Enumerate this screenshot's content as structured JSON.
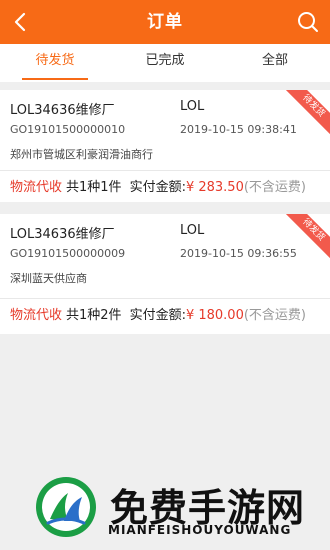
{
  "header": {
    "title": "订单",
    "back_icon": "chevron-left-icon",
    "search_icon": "search-icon"
  },
  "tabs": [
    {
      "label": "待发货",
      "active": true
    },
    {
      "label": "已完成",
      "active": false
    },
    {
      "label": "全部",
      "active": false
    }
  ],
  "orders": [
    {
      "shop": "LOL34636维修厂",
      "buyer": "LOL",
      "order_no": "GO19101500000010",
      "time": "2019-10-15 09:38:41",
      "supplier": "郑州市管城区利豪润滑油商行",
      "type_tag": "物流代收",
      "quantity": "共1种1件",
      "pay_label": "实付金额:",
      "amount": "¥ 283.50",
      "freight_note": "(不含运费)",
      "status": "待发货"
    },
    {
      "shop": "LOL34636维修厂",
      "buyer": "LOL",
      "order_no": "GO19101500000009",
      "time": "2019-10-15 09:36:55",
      "supplier": "深圳蓝天供应商",
      "type_tag": "物流代收",
      "quantity": "共1种2件",
      "pay_label": "实付金额:",
      "amount": "¥ 180.00",
      "freight_note": "(不含运费)",
      "status": "待发货"
    }
  ],
  "watermark": {
    "name_cn": "免费手游网",
    "name_en": "MIANFEISHOUYOUWANG"
  },
  "colors": {
    "accent": "#f76a16",
    "price": "#e63a2a",
    "ribbon": "#f25a4c"
  }
}
